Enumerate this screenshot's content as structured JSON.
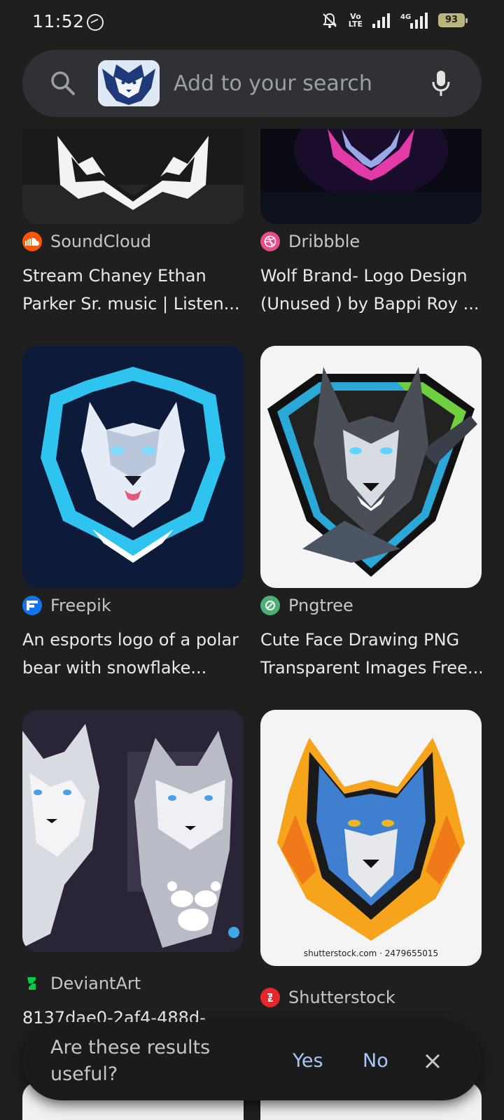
{
  "status_bar": {
    "time": "11:52",
    "network_type": "4G",
    "volte": "VoLTE",
    "battery": "93"
  },
  "search": {
    "placeholder": "Add to your search",
    "icons": [
      "search-icon",
      "mic-icon"
    ]
  },
  "results": [
    {
      "source": "SoundCloud",
      "source_color": "#ff5500",
      "title_line1": "Stream Chaney Ethan",
      "title_line2": "Parker Sr. music | Listen..."
    },
    {
      "source": "Dribbble",
      "source_color": "#ea4c89",
      "title_line1": "Wolf Brand- Logo Design",
      "title_line2": "(Unused ) by Bappi Roy ..."
    },
    {
      "source": "Freepik",
      "source_color": "#1273eb",
      "title_line1": "An esports logo of a polar",
      "title_line2": "bear with snowflake..."
    },
    {
      "source": "Pngtree",
      "source_color": "#4caf73",
      "title_line1": "Cute Face Drawing PNG",
      "title_line2": "Transparent Images Free..."
    },
    {
      "source": "DeviantArt",
      "source_color": "#05cc47",
      "title_line1": "8137dae0-2af4-488d-",
      "title_line2": ""
    },
    {
      "source": "Shutterstock",
      "source_color": "#e8262e",
      "title_line1": "",
      "title_line2": "",
      "watermark": "shutterstock.com · 2479655015"
    }
  ],
  "feedback": {
    "question": "Are these results useful?",
    "yes": "Yes",
    "no": "No"
  }
}
